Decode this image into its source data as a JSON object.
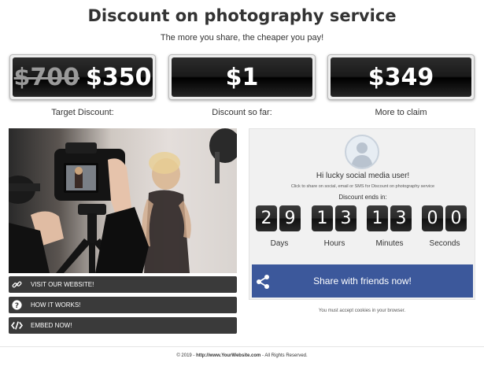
{
  "header": {
    "title": "Discount on photography service",
    "subtitle": "The more you share, the cheaper you pay!"
  },
  "prices": [
    {
      "old": "$700",
      "value": "$350",
      "label": "Target Discount:"
    },
    {
      "value": "$1",
      "label": "Discount so far:"
    },
    {
      "value": "$349",
      "label": "More to claim"
    }
  ],
  "actions": [
    {
      "label": "VISIT OUR WEBSITE!",
      "icon": "link-icon"
    },
    {
      "label": "HOW IT WORKS!",
      "icon": "question-icon"
    },
    {
      "label": "EMBED NOW!",
      "icon": "code-icon"
    }
  ],
  "panel": {
    "greeting": "Hi lucky social media user!",
    "instruction": "Click to share on social, email or SMS for Discount on photography service",
    "ends_label": "Discount ends in:",
    "countdown": {
      "days": [
        "2",
        "9"
      ],
      "hours": [
        "1",
        "3"
      ],
      "minutes": [
        "1",
        "3"
      ],
      "seconds": [
        "0",
        "0"
      ]
    },
    "units": {
      "days": "Days",
      "hours": "Hours",
      "minutes": "Minutes",
      "seconds": "Seconds"
    },
    "share_label": "Share with friends now!"
  },
  "cookies_note": "You must accept cookies in your browser.",
  "footer": {
    "prefix": "© 2019 - ",
    "link": "http://www.YourWebsite.com",
    "suffix": " - All Rights Reserved."
  },
  "colors": {
    "share_button": "#3c589b",
    "action_button": "#3a3a3a",
    "counter": "#1a1a1a"
  }
}
